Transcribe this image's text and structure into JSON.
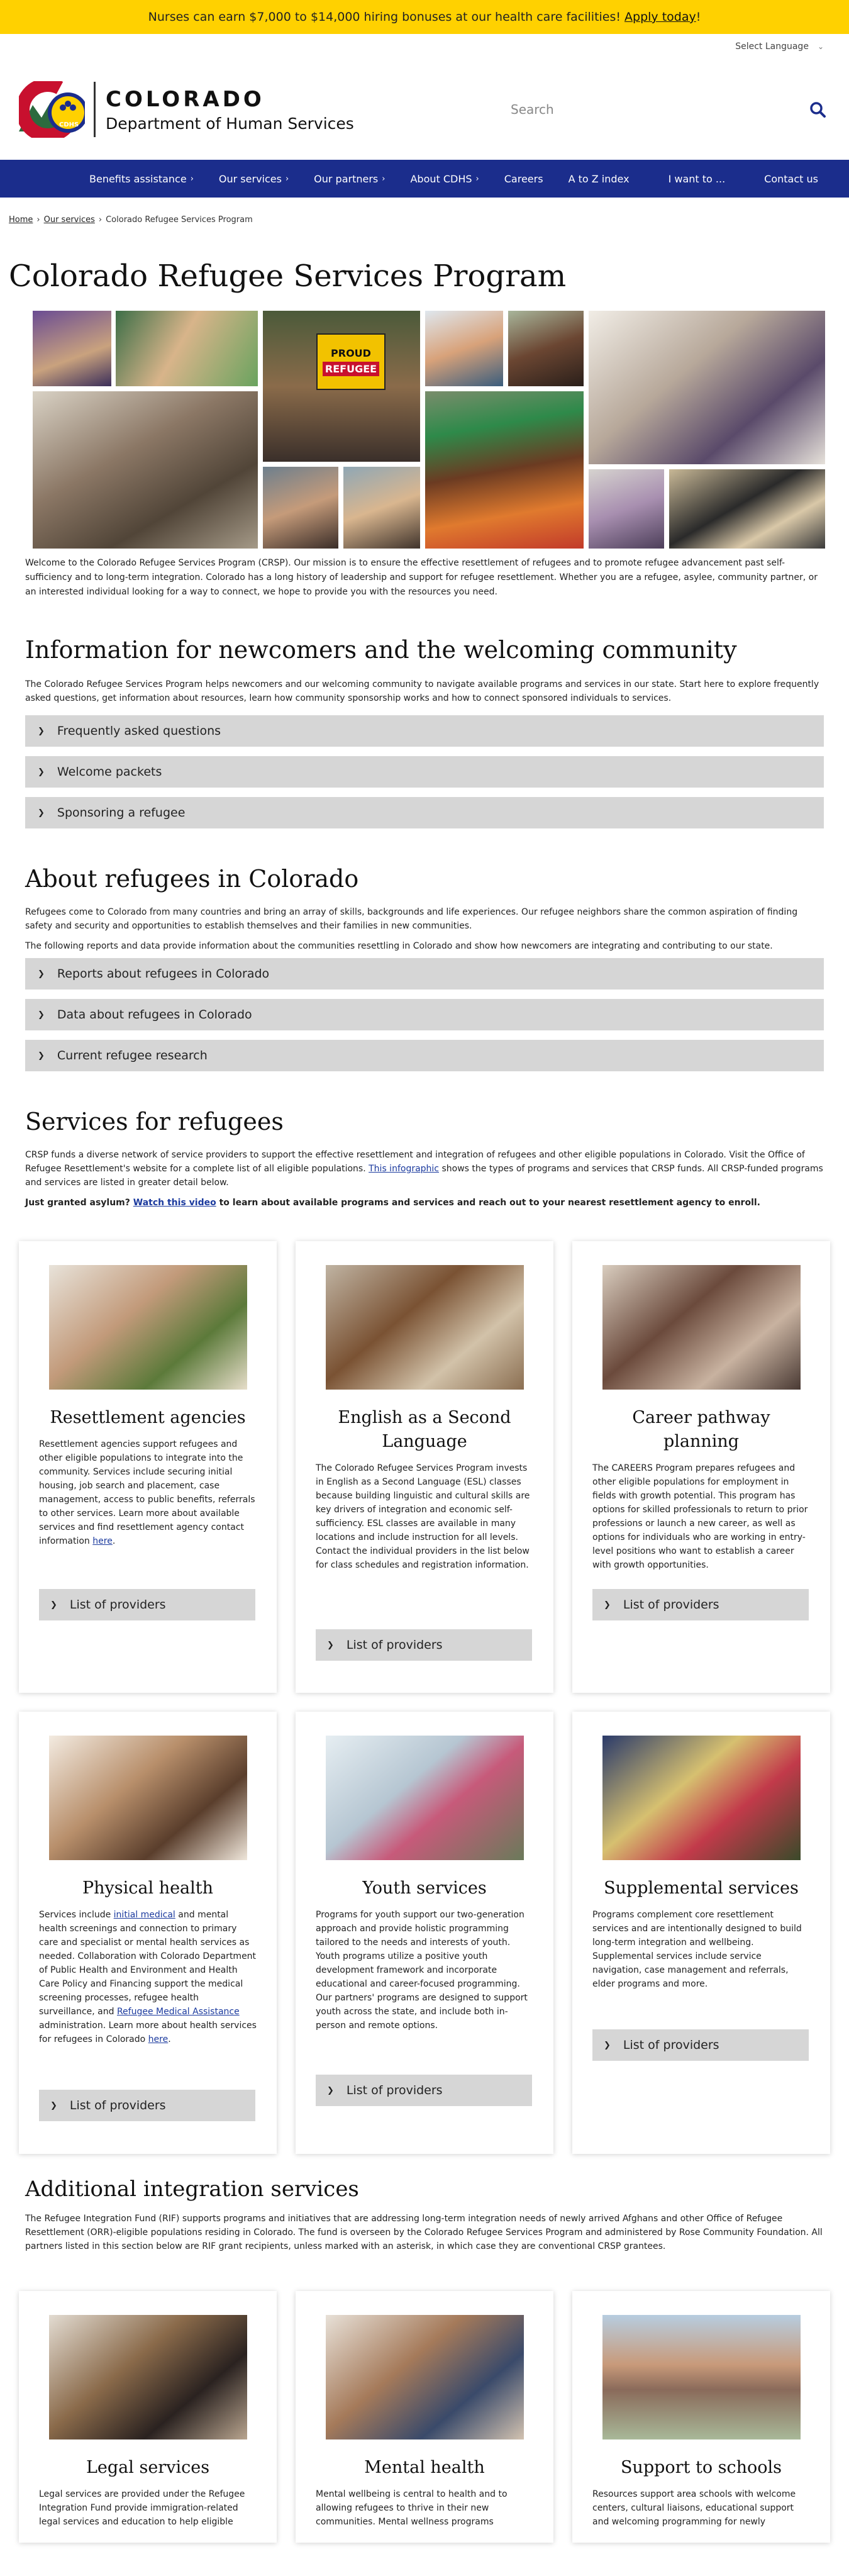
{
  "alert": {
    "text": "Nurses can earn $7,000 to $14,000 hiring bonuses at our health care facilities!",
    "link": "Apply today",
    "tail": "!"
  },
  "language": {
    "label": "Select Language"
  },
  "logo": {
    "line1": "COLORADO",
    "line2": "Department of Human Services",
    "badge": "CDHS"
  },
  "search": {
    "placeholder": "Search"
  },
  "nav": {
    "items": [
      "Benefits assistance",
      "Our services",
      "Our partners",
      "About CDHS",
      "Careers",
      "A to Z index",
      "I want to ...",
      "Contact us"
    ]
  },
  "breadcrumb": {
    "home": "Home",
    "services": "Our services",
    "current": "Colorado Refugee Services Program"
  },
  "page": {
    "title": "Colorado Refugee Services Program"
  },
  "collage": {
    "sign_line1": "PROUD",
    "sign_line2": "REFUGEE"
  },
  "intro": "Welcome to the Colorado Refugee Services Program (CRSP). Our mission is to ensure the effective resettlement of refugees and to promote refugee advancement past self-sufficiency and to long-term integration. Colorado has a long history of leadership and support for refugee resettlement. Whether you are a refugee, asylee, community partner, or an interested individual looking for a way to connect, we hope to provide you with the resources you need.",
  "newcomers": {
    "title": "Information for newcomers and the welcoming community",
    "text": "The Colorado Refugee Services Program helps newcomers and our welcoming community to navigate available programs and services in our state. Start here to explore frequently asked questions, get information about resources, learn how community sponsorship works and how to connect sponsored individuals to services.",
    "accordions": [
      "Frequently asked questions",
      "Welcome packets",
      "Sponsoring a refugee"
    ]
  },
  "about": {
    "title": "About refugees in Colorado",
    "text1": "Refugees come to Colorado from many countries and bring an array of skills, backgrounds and life experiences. Our refugee neighbors share the common aspiration of finding safety and security and opportunities to establish themselves and their families in new communities.",
    "text2": "The following reports and data provide information about the communities resettling in Colorado and show how newcomers are integrating and contributing to our state.",
    "accordions": [
      "Reports about refugees in Colorado",
      "Data about refugees in Colorado",
      "Current refugee research"
    ]
  },
  "services": {
    "title": "Services for refugees",
    "text_a": "CRSP funds a diverse network of service providers to support the effective resettlement and integration of refugees and other eligible populations in Colorado. Visit the Office of Refugee Resettlement's website for a complete list of all eligible populations.",
    "text_link": "This infographic",
    "text_b": "shows the types of programs and services that CRSP funds. All CRSP-funded programs and services are listed in greater detail below.",
    "asylum_a": "Just granted asylum?",
    "asylum_link": "Watch this video",
    "asylum_b": "to learn about available programs and services and reach out to your nearest resettlement agency to enroll.",
    "button": "List of providers",
    "cards": [
      {
        "title": "Resettlement agencies",
        "text": "Resettlement agencies support refugees and other eligible populations to integrate into the community. Services include securing initial housing, job search and placement, case management, access to public benefits, referrals to other services. Learn more about available services and find resettlement agency contact information",
        "link": "here",
        "tail": "."
      },
      {
        "title": "English as a Second Language",
        "text": "The Colorado Refugee Services Program invests in English as a Second Language (ESL) classes because building linguistic and cultural skills are key drivers of integration and economic self-sufficiency. ESL classes are available in many locations and include instruction for all levels. Contact the individual providers in the list below for class schedules and registration information."
      },
      {
        "title": "Career pathway planning",
        "text": "The CAREERS Program prepares refugees and other eligible populations for employment in fields with growth potential. This program has options for skilled professionals to return to prior professions or launch a new career, as well as options for individuals who are working in entry-level positions who want to establish a career with growth opportunities."
      },
      {
        "title": "Physical health",
        "text_a": "Services include",
        "link1": "initial medical",
        "text_b": "and mental health screenings and connection to primary care and specialist or mental health services as needed. Collaboration with Colorado Department of Public Health and Environment and Health Care Policy and Financing support the medical screening processes, refugee health surveillance, and",
        "link2": "Refugee Medical Assistance",
        "text_c": "administration. Learn more about health services for refugees in Colorado",
        "link3": "here",
        "tail": "."
      },
      {
        "title": "Youth services",
        "text": "Programs for youth support our two-generation approach and provide holistic programming tailored to the needs and interests of youth. Youth programs utilize a positive youth development framework and incorporate educational and career-focused programming. Our partners' programs are designed to support youth across the state, and include both in-person and remote options."
      },
      {
        "title": "Supplemental services",
        "text": "Programs complement core resettlement services and are intentionally designed to build long-term integration and wellbeing. Supplemental services include service navigation, case management and referrals, elder programs and more."
      }
    ]
  },
  "additional": {
    "title": "Additional integration services",
    "text": "The Refugee Integration Fund (RIF) supports programs and initiatives that are addressing long-term integration needs of newly arrived Afghans and other Office of Refugee Resettlement (ORR)-eligible populations residing in Colorado. The fund is overseen by the Colorado Refugee Services Program and administered by Rose Community Foundation. All partners listed in this section below are RIF grant recipients, unless marked with an asterisk, in which case they are conventional CRSP grantees.",
    "cards": [
      {
        "title": "Legal services",
        "text": "Legal services are provided under the Refugee Integration Fund provide immigration-related legal services and education to help eligible"
      },
      {
        "title": "Mental health",
        "text": "Mental wellbeing is central to health and to allowing refugees to thrive in their new communities. Mental wellness programs"
      },
      {
        "title": "Support to schools",
        "text": "Resources support area schools with welcome centers, cultural liaisons, educational support and welcoming programming for newly"
      }
    ]
  }
}
